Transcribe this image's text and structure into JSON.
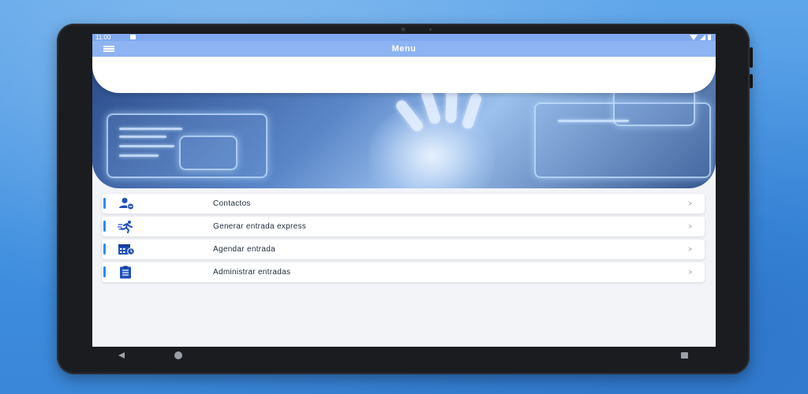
{
  "status_bar": {
    "time": "11:00"
  },
  "app_bar": {
    "title": "Menu",
    "menu_icon": "hamburger-icon"
  },
  "menu": {
    "items": [
      {
        "label": "Contactos",
        "icon": "contacts-icon",
        "chevron": ">"
      },
      {
        "label": "Generar entrada express",
        "icon": "express-runner-icon",
        "chevron": ">"
      },
      {
        "label": "Agendar entrada",
        "icon": "calendar-icon",
        "chevron": ">"
      },
      {
        "label": "Administrar entradas",
        "icon": "clipboard-list-icon",
        "chevron": ">"
      }
    ]
  },
  "colors": {
    "accent": "#2e8cf0",
    "app_bar": "#8eb3f2",
    "icon_blue": "#1e4fbf",
    "screen_bg": "#f2f4f8"
  }
}
